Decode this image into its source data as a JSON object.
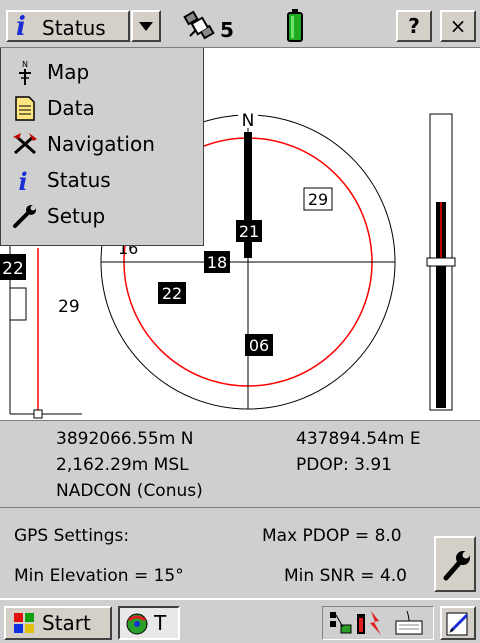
{
  "topbar": {
    "section_label": "Status",
    "satellite_count": "5",
    "help_label": "?",
    "close_label": "×"
  },
  "menu": {
    "items": [
      {
        "label": "Map",
        "icon": "north-arrow-icon"
      },
      {
        "label": "Data",
        "icon": "document-icon"
      },
      {
        "label": "Navigation",
        "icon": "crossed-tools-icon"
      },
      {
        "label": "Status",
        "icon": "info-icon"
      },
      {
        "label": "Setup",
        "icon": "wrench-icon"
      }
    ]
  },
  "skyplot": {
    "north_label": "N",
    "satellites": [
      "29",
      "21",
      "18",
      "22",
      "06",
      "16"
    ],
    "left_sat_id": "22",
    "left_sat_value": "29"
  },
  "info": {
    "northing": "3892066.55m N",
    "easting": "437894.54m E",
    "altitude": "2,162.29m MSL",
    "pdop": "PDOP: 3.91",
    "datum": "NADCON (Conus)"
  },
  "settings": {
    "title": "GPS Settings:",
    "max_pdop": "Max PDOP = 8.0",
    "min_elevation": "Min Elevation = 15°",
    "min_snr": "Min SNR = 4.0"
  },
  "taskbar": {
    "start_label": "Start",
    "task_label": "T"
  },
  "colors": {
    "chrome": "#cfcfcf",
    "accent_blue": "#1a2ed6",
    "elevation_mask": "#ff0000",
    "battery_green": "#1faa1f"
  }
}
